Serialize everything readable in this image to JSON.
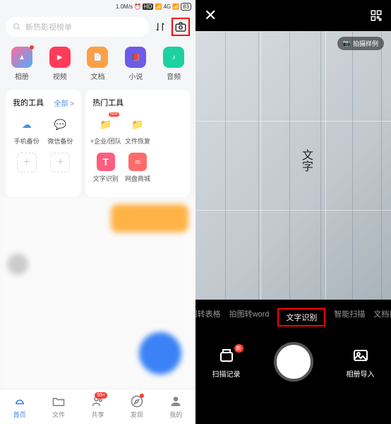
{
  "status": {
    "speed": "1.0M/s",
    "alarm": "⏰",
    "hd": "HD",
    "signal": "📶",
    "net": "4G",
    "battery": "83"
  },
  "search": {
    "placeholder": "新热影视榜单"
  },
  "categories": [
    {
      "label": "相册",
      "color": "#fff",
      "glyph": "▲"
    },
    {
      "label": "视频",
      "color": "#ff3b5c",
      "glyph": "▶"
    },
    {
      "label": "文档",
      "color": "#ff9f43",
      "glyph": "📄"
    },
    {
      "label": "小说",
      "color": "#6c5ce7",
      "glyph": "📕"
    },
    {
      "label": "音频",
      "color": "#1dd1a1",
      "glyph": "♪"
    }
  ],
  "my_tools": {
    "title": "我的工具",
    "all": "全部 >",
    "items": [
      {
        "label": "手机备份",
        "glyph": "☁",
        "color": "#4a90e2"
      },
      {
        "label": "微信备份",
        "glyph": "💬",
        "color": "#4cd964"
      }
    ]
  },
  "hot_tools": {
    "title": "热门工具",
    "items": [
      {
        "label": "+企业/团队",
        "glyph": "📁",
        "color": "#ffb347",
        "badge": "new"
      },
      {
        "label": "文件恢复",
        "glyph": "📁",
        "color": "#ffd54f"
      },
      {
        "label": "文字识别",
        "glyph": "T",
        "color": "#ff5e7e"
      },
      {
        "label": "网盘商城",
        "glyph": "≈",
        "color": "#ff6b6b"
      }
    ]
  },
  "tabs": [
    {
      "label": "首页",
      "glyph": "cloud",
      "active": true
    },
    {
      "label": "文件",
      "glyph": "folder"
    },
    {
      "label": "共享",
      "glyph": "users",
      "badge": "99+"
    },
    {
      "label": "发现",
      "glyph": "compass",
      "dot": true
    },
    {
      "label": "我的",
      "glyph": "person"
    }
  ],
  "camera": {
    "sample": "拍摄样例",
    "doc_text": "文字",
    "modes": [
      "拍图转表格",
      "拍图转word",
      "文字识别",
      "智能扫描",
      "文档扫描"
    ],
    "active_mode": 2,
    "scan_history": "扫描记录",
    "scan_badge": "新",
    "import": "相册导入"
  }
}
